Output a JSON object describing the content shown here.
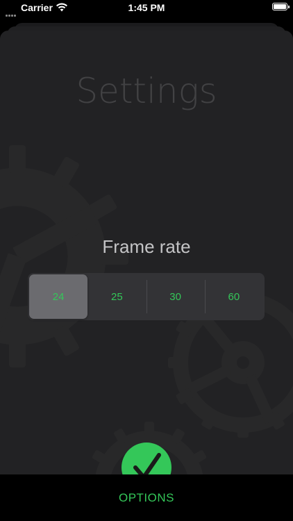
{
  "status_bar": {
    "carrier": "Carrier",
    "time": "1:45 PM"
  },
  "settings": {
    "title": "Settings",
    "frame_rate_label": "Frame rate",
    "frame_rate_options": [
      "24",
      "25",
      "30",
      "60"
    ],
    "selected_frame_rate": "24"
  },
  "bottom_bar": {
    "options_label": "OPTIONS"
  },
  "colors": {
    "accent": "#34c759",
    "background": "#222224",
    "segmented_bg": "#333336",
    "segment_selected": "#6b6b6f"
  },
  "icons": {
    "confirm": "checkmark-icon",
    "background": "gear-icon"
  }
}
